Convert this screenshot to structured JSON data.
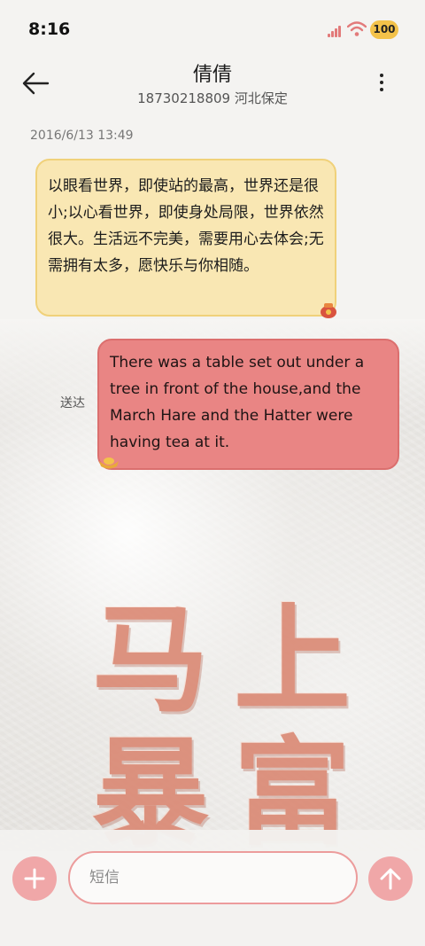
{
  "status_bar": {
    "time": "8:16",
    "battery": "100"
  },
  "header": {
    "contact_name": "倩倩",
    "contact_subtitle": "18730218809 河北保定"
  },
  "conversation": {
    "timestamp": "2016/6/13 13:49",
    "messages": [
      {
        "direction": "incoming",
        "text": "以眼看世界，即使站的最高，世界还是很小;以心看世界，即使身处局限，世界依然很大。生活远不完美，需要用心去体会;无需拥有太多，愿快乐与你相随。"
      },
      {
        "direction": "outgoing",
        "status": "送达",
        "text": "There was a table set out under a tree in front of the house,and the March Hare and the Hatter were having tea at it."
      }
    ]
  },
  "background": {
    "characters": [
      "马",
      "上",
      "暴",
      "富"
    ]
  },
  "composer": {
    "placeholder": "短信",
    "value": ""
  },
  "colors": {
    "incoming_bubble": "#f9e7b3",
    "outgoing_bubble": "#e98584",
    "accent": "#f0a7a8"
  },
  "icons": {
    "back": "arrow-left",
    "more": "vertical-ellipsis",
    "add": "plus",
    "send": "arrow-up"
  }
}
